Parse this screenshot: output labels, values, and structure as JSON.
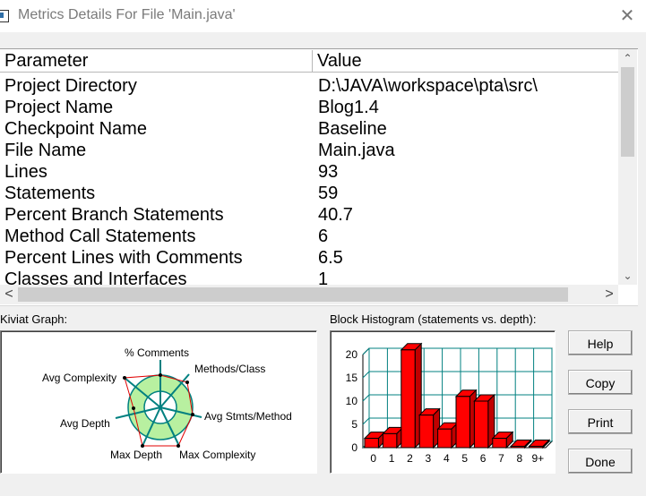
{
  "window": {
    "title": "Metrics Details For File 'Main.java'",
    "close_glyph": "✕"
  },
  "table": {
    "headers": [
      "Parameter",
      "Value"
    ],
    "rows": [
      [
        "Project Directory",
        "D:\\JAVA\\workspace\\pta\\src\\"
      ],
      [
        "Project Name",
        "Blog1.4"
      ],
      [
        "Checkpoint Name",
        "Baseline"
      ],
      [
        "File Name",
        "Main.java"
      ],
      [
        "Lines",
        "93"
      ],
      [
        "Statements",
        "59"
      ],
      [
        "Percent Branch Statements",
        "40.7"
      ],
      [
        "Method Call Statements",
        "6"
      ],
      [
        "Percent Lines with Comments",
        "6.5"
      ],
      [
        "Classes and Interfaces",
        "1"
      ]
    ]
  },
  "scrollbars": {
    "up": "⌃",
    "down": "⌄",
    "left": "<",
    "right": ">"
  },
  "kiviat": {
    "label": "Kiviat Graph:",
    "axes": [
      "% Comments",
      "Methods/Class",
      "Avg Stmts/Method",
      "Max Complexity",
      "Max Depth",
      "Avg Depth",
      "Avg Complexity"
    ],
    "colors": {
      "ring": "#b8f0a0",
      "spokes": "#008080",
      "polygon": "#e00000"
    }
  },
  "histogram": {
    "label": "Block Histogram (statements vs. depth):",
    "bar_color": "#ff0000"
  },
  "chart_data": {
    "type": "bar",
    "categories": [
      "0",
      "1",
      "2",
      "3",
      "4",
      "5",
      "6",
      "7",
      "8",
      "9+"
    ],
    "values": [
      2,
      3,
      21,
      7,
      4,
      11,
      10,
      2,
      0,
      0
    ],
    "ylim": [
      0,
      20
    ],
    "yticks": [
      "0",
      "5",
      "10",
      "15",
      "20"
    ],
    "grid": true
  },
  "buttons": {
    "help": "Help",
    "copy": "Copy",
    "print": "Print",
    "done": "Done"
  }
}
